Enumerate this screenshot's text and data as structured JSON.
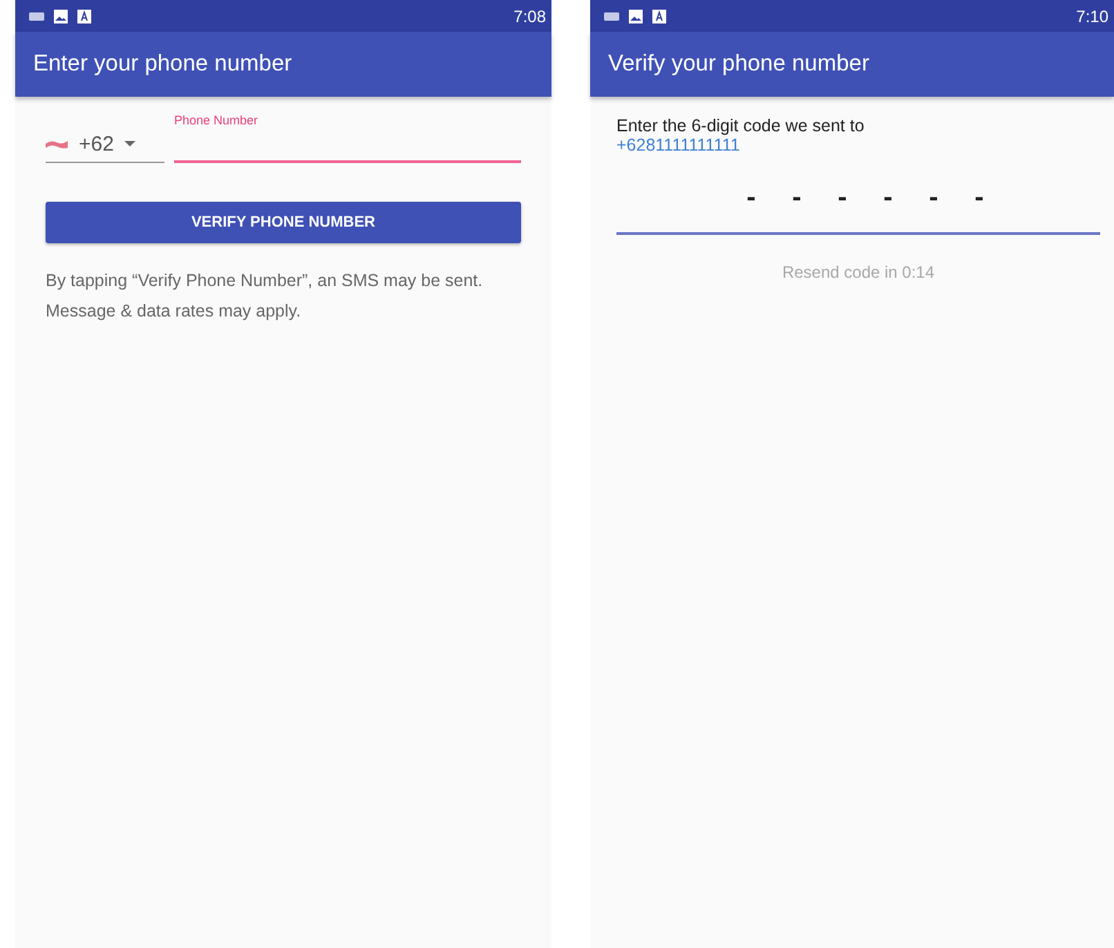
{
  "screens": [
    {
      "kind": "phone_entry",
      "status_bar": {
        "time": "7:08"
      },
      "app_bar": {
        "title": "Enter your phone number"
      },
      "country_code": "+62",
      "phone_field": {
        "label": "Phone Number",
        "focused": true
      },
      "verify_button": "VERIFY PHONE NUMBER",
      "disclaimer": [
        "By tapping “Verify Phone Number”, an SMS may be sent.",
        "Message & data rates may apply."
      ]
    },
    {
      "kind": "code_entry",
      "status_bar": {
        "time": "7:10"
      },
      "app_bar": {
        "title": "Verify your phone number"
      },
      "prompt": "Enter the 6-digit code we sent to",
      "phone_number": "+6281111111111",
      "code_slots": [
        "-",
        "-",
        "-",
        "-",
        "-",
        "-"
      ],
      "resend": {
        "text": "Resend code in 0:14",
        "disabled": true
      }
    }
  ]
}
